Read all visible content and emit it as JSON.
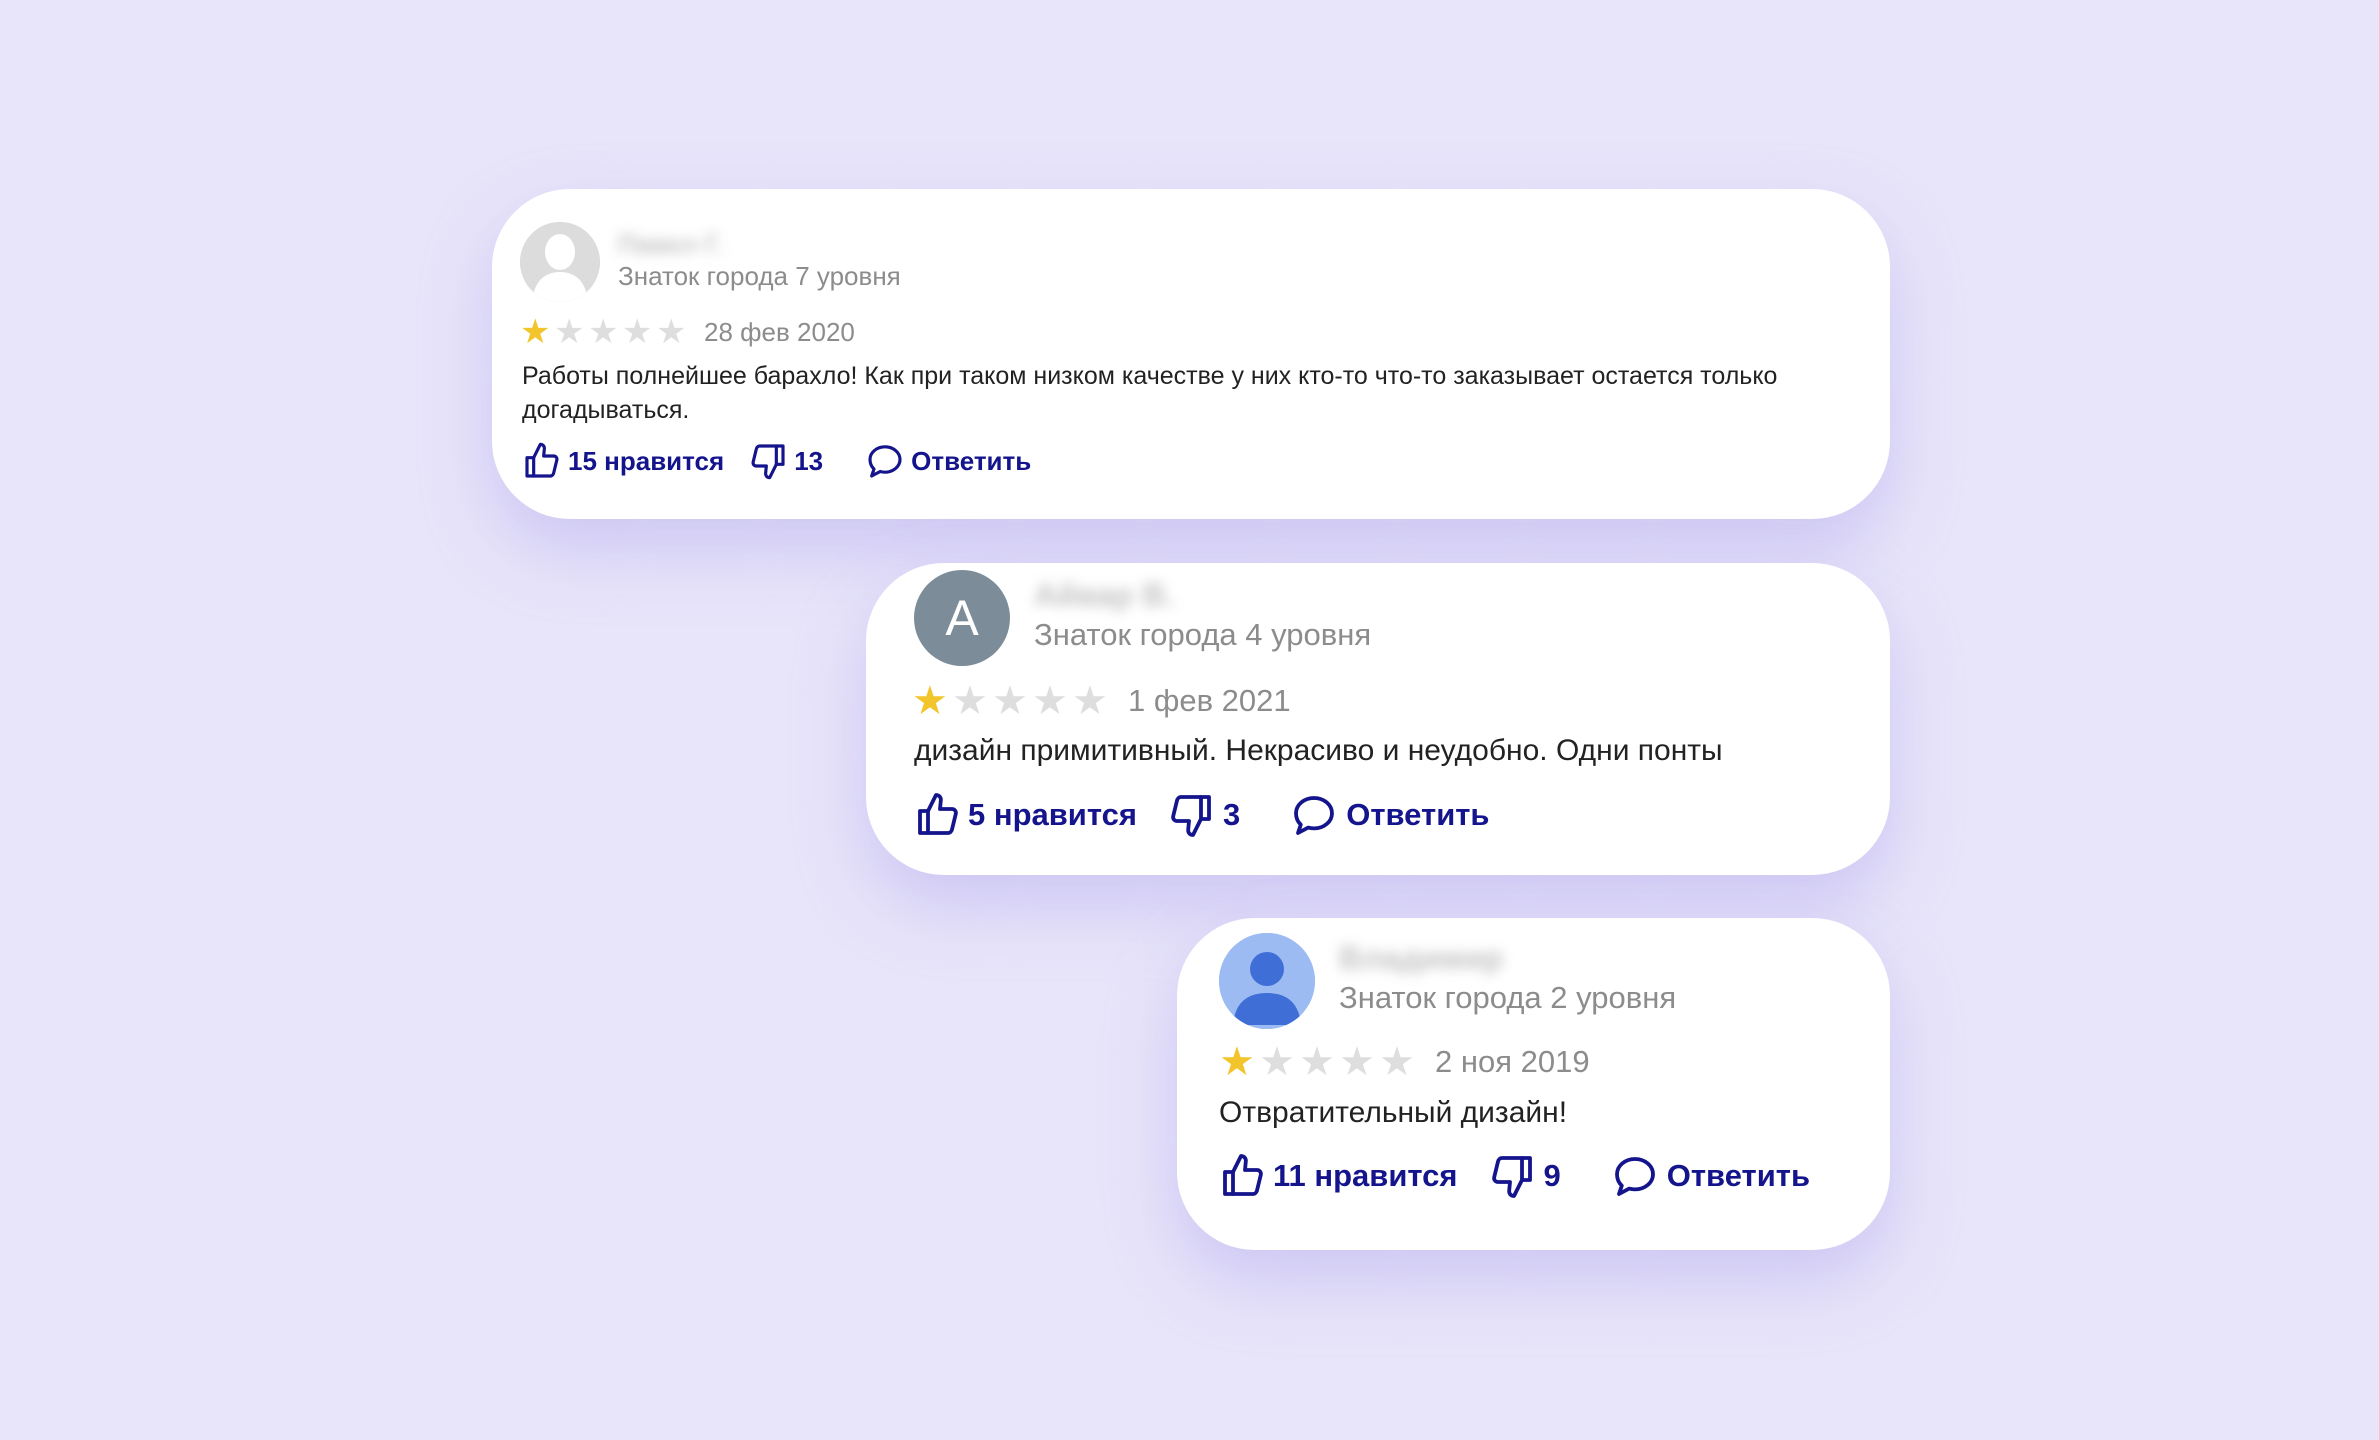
{
  "colors": {
    "background": "#e8e5fa",
    "card": "#ffffff",
    "star_filled": "#f2c52c",
    "star_empty": "#dedede",
    "action_text": "#14148c",
    "muted_text": "#8c8c8c"
  },
  "reviews": [
    {
      "avatar_icon": "user-silhouette-icon",
      "name_blurred": "Павел Г.",
      "level": "Знаток города 7 уровня",
      "rating": 1,
      "rating_max": 5,
      "date": "28 фев 2020",
      "text": "Работы полнейшее барахло! Как при таком низком качестве у них кто-то что-то заказывает остается только догадываться.",
      "likes_label": "15 нравится",
      "dislikes": "13",
      "reply_label": "Ответить"
    },
    {
      "avatar_letter": "А",
      "name_blurred": "Айвар В.",
      "level": "Знаток города 4 уровня",
      "rating": 1,
      "rating_max": 5,
      "date": "1 фев 2021",
      "text": "дизайн примитивный. Некрасиво и неудобно. Одни понты",
      "likes_label": "5 нравится",
      "dislikes": "3",
      "reply_label": "Ответить"
    },
    {
      "avatar_icon": "default-person-icon",
      "name_blurred": "Владимир",
      "level": "Знаток города 2 уровня",
      "rating": 1,
      "rating_max": 5,
      "date": "2 ноя 2019",
      "text": "Отвратительный дизайн!",
      "likes_label": "11 нравится",
      "dislikes": "9",
      "reply_label": "Ответить"
    }
  ]
}
